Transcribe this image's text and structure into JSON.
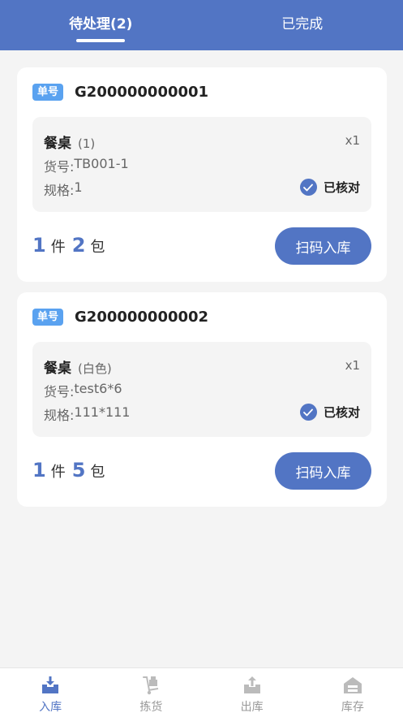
{
  "tabs": [
    {
      "label": "待处理(2)",
      "active": true
    },
    {
      "label": "已完成",
      "active": false
    }
  ],
  "orders": [
    {
      "badge": "单号",
      "order_no": "G200000000001",
      "item": {
        "name": "餐桌",
        "variant": "(1)",
        "qty": "x1",
        "sku_label": "货号: ",
        "sku": "TB001-1",
        "spec_label": "规格: ",
        "spec": "1",
        "status": "已核对"
      },
      "count": {
        "pieces": "1",
        "pieces_unit": "件",
        "packages": "2",
        "packages_unit": "包"
      },
      "action": "扫码入库"
    },
    {
      "badge": "单号",
      "order_no": "G200000000002",
      "item": {
        "name": "餐桌",
        "variant": "(白色)",
        "qty": "x1",
        "sku_label": "货号: ",
        "sku": "test6*6",
        "spec_label": "规格: ",
        "spec": "111*111",
        "status": "已核对"
      },
      "count": {
        "pieces": "1",
        "pieces_unit": "件",
        "packages": "5",
        "packages_unit": "包"
      },
      "action": "扫码入库"
    }
  ],
  "bottom_nav": [
    {
      "label": "入库",
      "icon": "inbox-download-icon",
      "active": true
    },
    {
      "label": "拣货",
      "icon": "hand-truck-icon",
      "active": false
    },
    {
      "label": "出库",
      "icon": "outbox-upload-icon",
      "active": false
    },
    {
      "label": "库存",
      "icon": "warehouse-icon",
      "active": false
    }
  ],
  "colors": {
    "primary": "#5275c4",
    "badge": "#5aa2f0",
    "background": "#f4f4f4"
  }
}
